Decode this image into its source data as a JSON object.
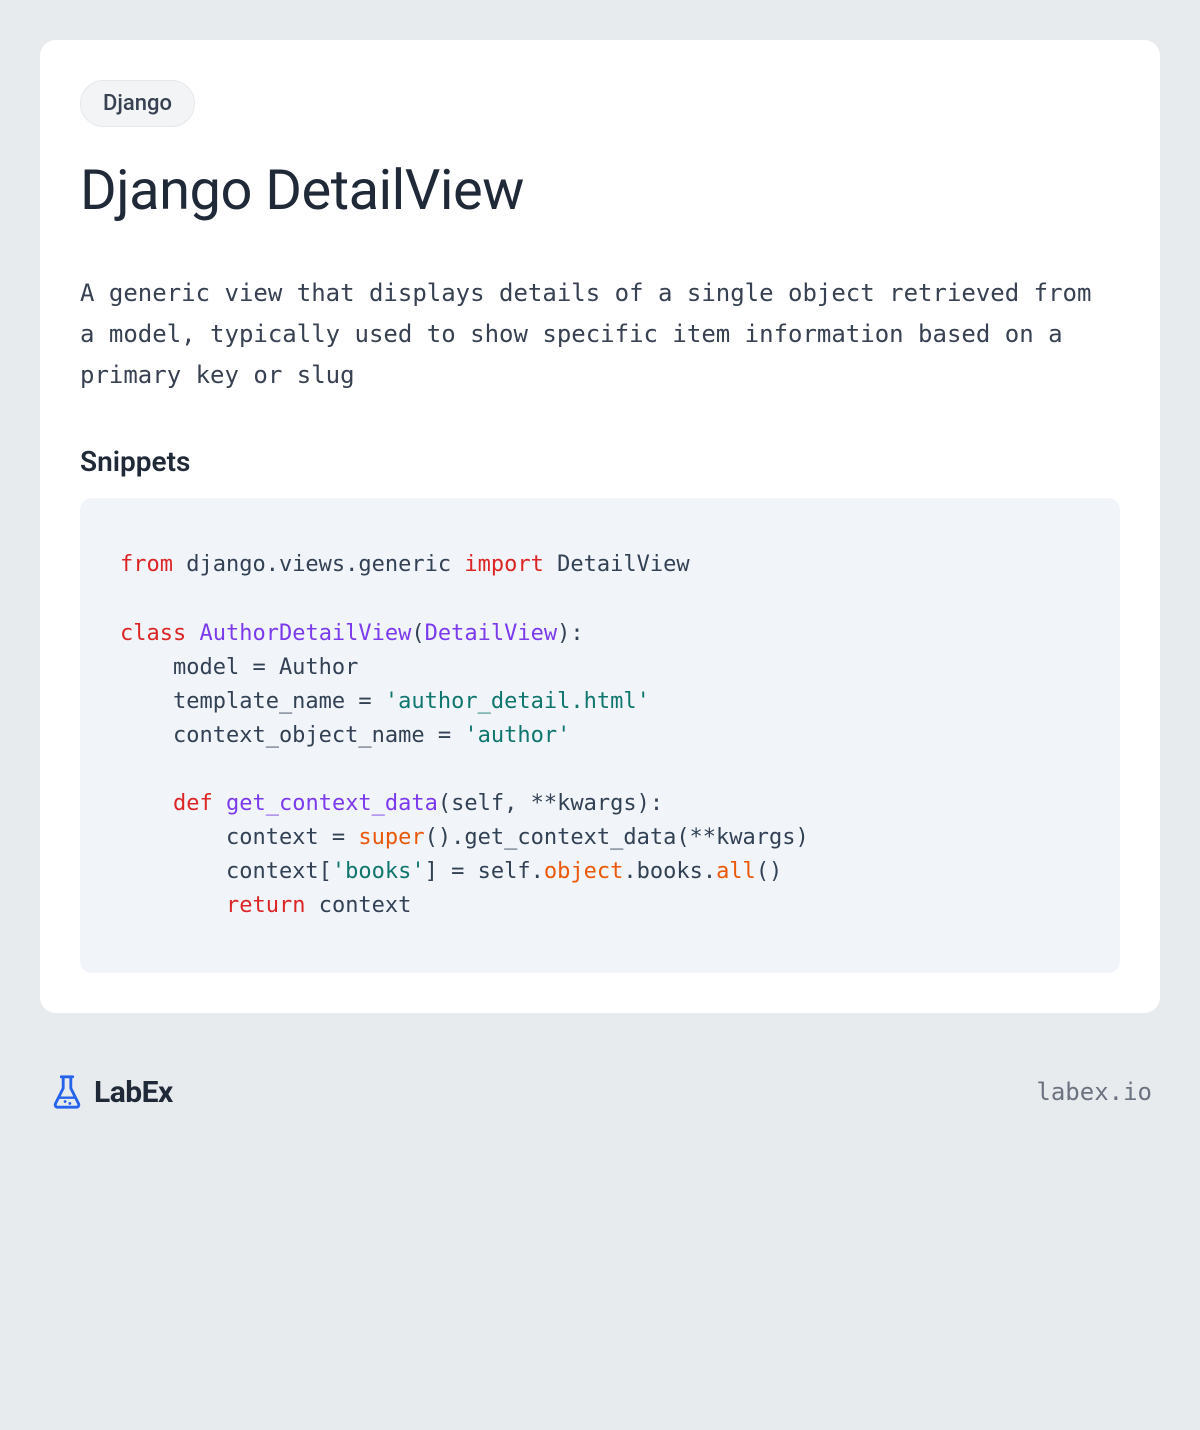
{
  "tag": "Django",
  "title": "Django DetailView",
  "description": "A generic view that displays details of a single object retrieved from a model, typically used to show specific item information based on a primary key or slug",
  "snippets_heading": "Snippets",
  "code": {
    "tokens": [
      {
        "t": "from",
        "c": "kw-red"
      },
      {
        "t": " django.views.generic "
      },
      {
        "t": "import",
        "c": "kw-red"
      },
      {
        "t": " DetailView\n\n"
      },
      {
        "t": "class",
        "c": "kw-red"
      },
      {
        "t": " "
      },
      {
        "t": "AuthorDetailView",
        "c": "kw-purple"
      },
      {
        "t": "("
      },
      {
        "t": "DetailView",
        "c": "kw-purple"
      },
      {
        "t": "):\n"
      },
      {
        "t": "    model = Author\n"
      },
      {
        "t": "    template_name = "
      },
      {
        "t": "'author_detail.html'",
        "c": "str-green"
      },
      {
        "t": "\n"
      },
      {
        "t": "    context_object_name = "
      },
      {
        "t": "'author'",
        "c": "str-green"
      },
      {
        "t": "\n\n"
      },
      {
        "t": "    "
      },
      {
        "t": "def",
        "c": "kw-red"
      },
      {
        "t": " "
      },
      {
        "t": "get_context_data",
        "c": "kw-purple"
      },
      {
        "t": "(self, **kwargs):\n"
      },
      {
        "t": "        context = "
      },
      {
        "t": "super",
        "c": "kw-orange"
      },
      {
        "t": "().get_context_data(**kwargs)\n"
      },
      {
        "t": "        context["
      },
      {
        "t": "'books'",
        "c": "str-green"
      },
      {
        "t": "] = self."
      },
      {
        "t": "object",
        "c": "kw-orange"
      },
      {
        "t": ".books."
      },
      {
        "t": "all",
        "c": "kw-orange"
      },
      {
        "t": "()\n"
      },
      {
        "t": "        "
      },
      {
        "t": "return",
        "c": "kw-red"
      },
      {
        "t": " context"
      }
    ]
  },
  "footer": {
    "brand": "LabEx",
    "url": "labex.io"
  }
}
